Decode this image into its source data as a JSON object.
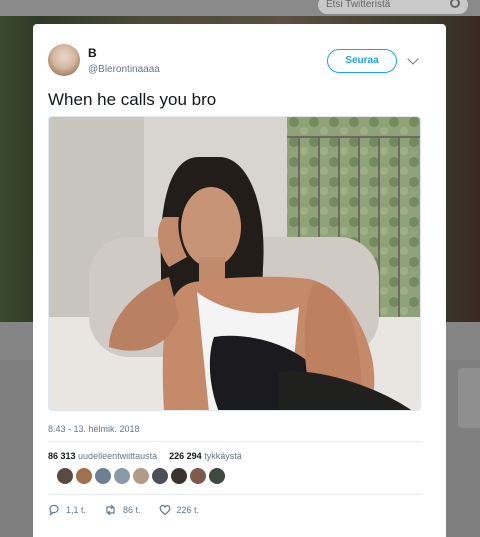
{
  "search": {
    "placeholder": "Etsi Twitteristä"
  },
  "tweet": {
    "author_name": "B",
    "author_handle": "@Blerontinaaaa",
    "follow_label": "Seuraa",
    "text": "When he calls you bro",
    "timestamp": "8.43 - 13. helmik. 2018",
    "retweet_count": "86 313",
    "retweet_label": "uudelleentwiittausta",
    "like_count": "226 294",
    "like_label": "tykkäystä",
    "replies": "1,1 t.",
    "retweets_short": "86 t.",
    "likes_short": "226 t."
  },
  "colors": {
    "accent": "#1da1f2",
    "text": "#14171a",
    "muted": "#657786"
  },
  "icons": [
    "search-icon",
    "chevron-down-icon",
    "reply-icon",
    "retweet-icon",
    "like-icon"
  ]
}
